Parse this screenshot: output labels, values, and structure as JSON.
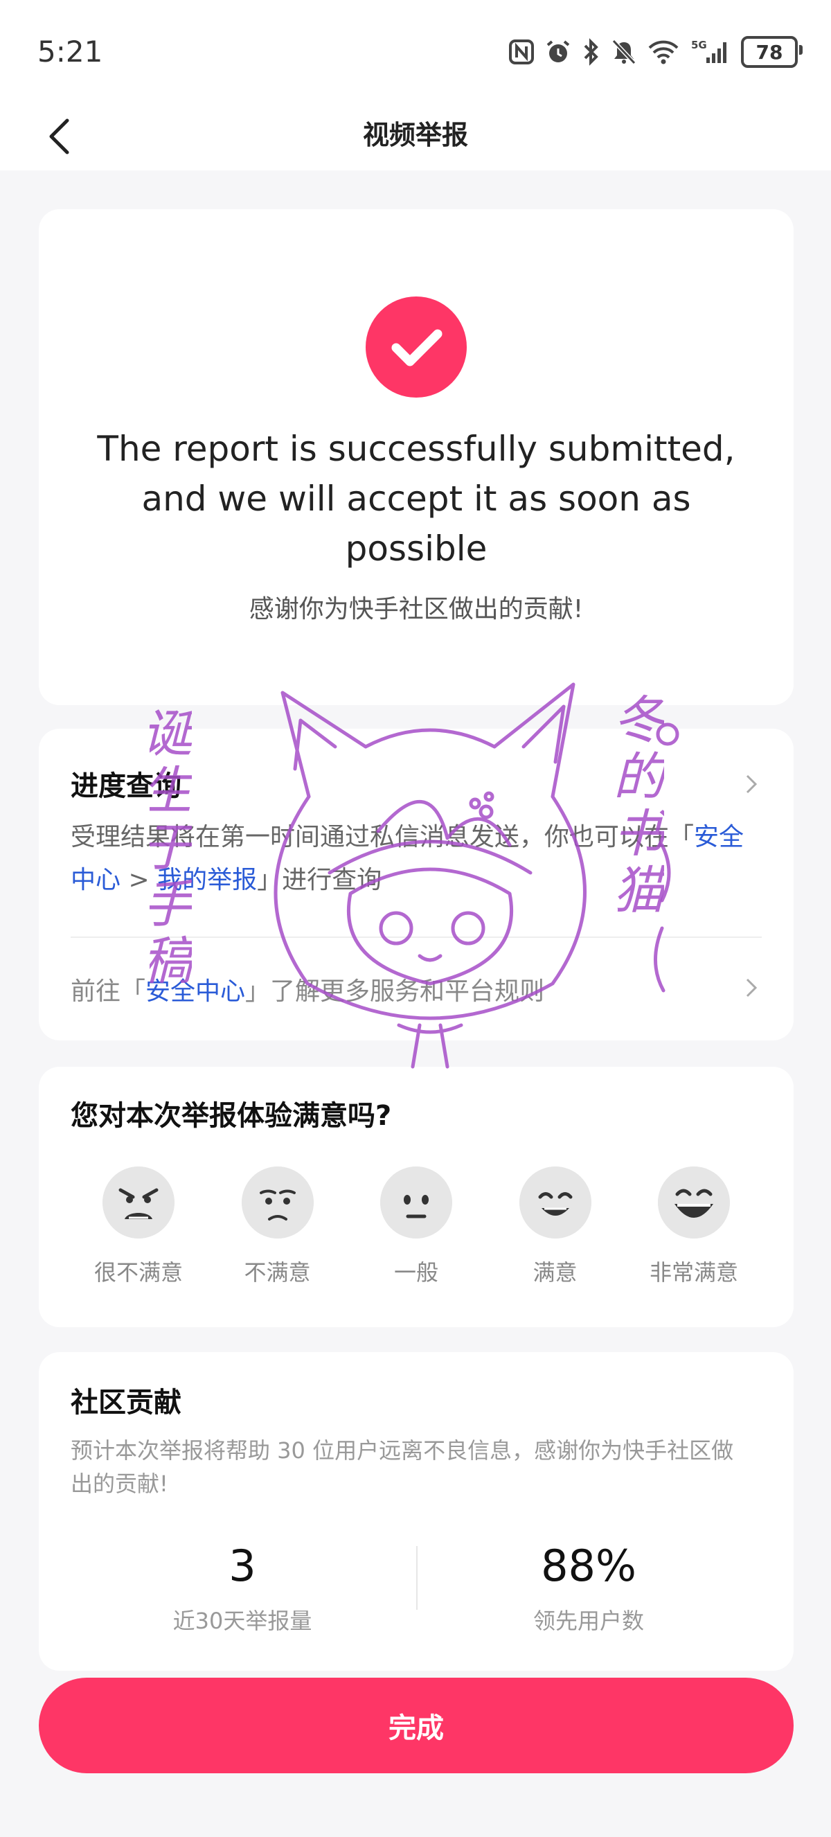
{
  "status_bar": {
    "time": "5:21",
    "battery": "78",
    "icons": [
      "nfc-icon",
      "alarm-icon",
      "bluetooth-icon",
      "mute-icon",
      "wifi-icon",
      "signal-5g-icon"
    ]
  },
  "header": {
    "title": "视频举报",
    "back_icon": "chevron-left-icon"
  },
  "success": {
    "icon": "check-circle-icon",
    "title": "The report is successfully submitted, and we will accept it as soon as possible",
    "subtitle": "感谢你为快手社区做出的贡献!"
  },
  "progress": {
    "title": "进度查询",
    "desc_prefix": "受理结果将在第一时间通过私信消息发送，你也可以在「",
    "link_security_center": "安全中心",
    "separator": " > ",
    "link_my_reports": "我的举报",
    "desc_suffix": "」进行查询",
    "goto_prefix": "前往「",
    "goto_link": "安全中心",
    "goto_suffix": "」了解更多服务和平台规则"
  },
  "survey": {
    "title": "您对本次举报体验满意吗?",
    "options": [
      {
        "label": "很不满意",
        "icon": "angry-face-icon"
      },
      {
        "label": "不满意",
        "icon": "unhappy-face-icon"
      },
      {
        "label": "一般",
        "icon": "neutral-face-icon"
      },
      {
        "label": "满意",
        "icon": "smile-face-icon"
      },
      {
        "label": "非常满意",
        "icon": "grin-face-icon"
      }
    ]
  },
  "contribution": {
    "title": "社区贡献",
    "desc": "预计本次举报将帮助 30 位用户远离不良信息，感谢你为快手社区做出的贡献!",
    "stats": [
      {
        "value": "3",
        "label": "近30天举报量"
      },
      {
        "value": "88%",
        "label": "领先用户数"
      }
    ]
  },
  "done_button": "完成",
  "colors": {
    "accent": "#fe3666",
    "link": "#2a5bd7",
    "stamp": "#a64ec8"
  },
  "watermark": {
    "left_text": "诞生于手稿",
    "right_text": "冬的书猫",
    "icon": "cat-stamp-icon"
  }
}
